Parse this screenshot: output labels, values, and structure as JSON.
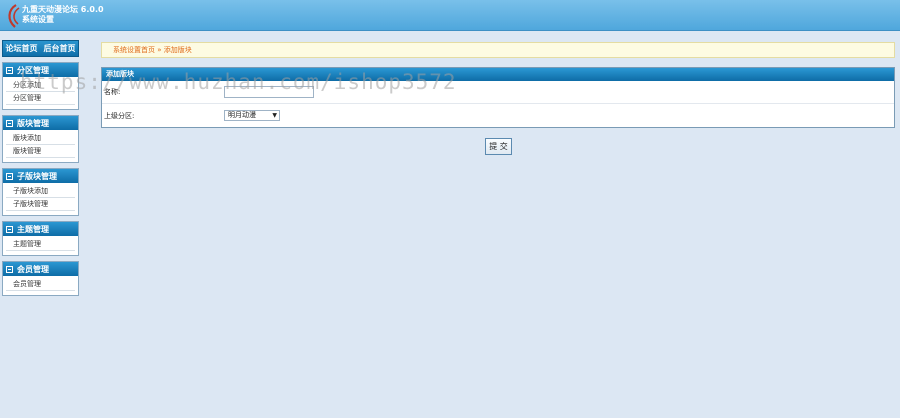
{
  "header": {
    "title_line1": "九重天动漫论坛 6.0.0",
    "title_line2": "系统设置"
  },
  "sidebar": {
    "home_links": [
      "论坛首页",
      "后台首页"
    ],
    "panels": [
      {
        "title": "分区管理",
        "items": [
          "分区添加",
          "分区管理"
        ]
      },
      {
        "title": "版块管理",
        "items": [
          "版块添加",
          "版块管理"
        ]
      },
      {
        "title": "子版块管理",
        "items": [
          "子版块添加",
          "子版块管理"
        ]
      },
      {
        "title": "主题管理",
        "items": [
          "主题管理"
        ]
      },
      {
        "title": "会员管理",
        "items": [
          "会员管理"
        ]
      }
    ]
  },
  "breadcrumb": {
    "home": "系统设置首页",
    "separator": "»",
    "current": "添加版块"
  },
  "form": {
    "title": "添加版块",
    "name_label": "名称:",
    "name_value": "",
    "parent_label": "上级分区:",
    "parent_selected": "明月动漫",
    "submit_label": "提 交"
  },
  "watermark": "https://www.huzhan.com/ishop3572",
  "colors": {
    "header": "#5cb0e0",
    "panel_head": "#1a80bb",
    "breadcrumb_text": "#e06b1b",
    "background": "#dce7f3"
  }
}
